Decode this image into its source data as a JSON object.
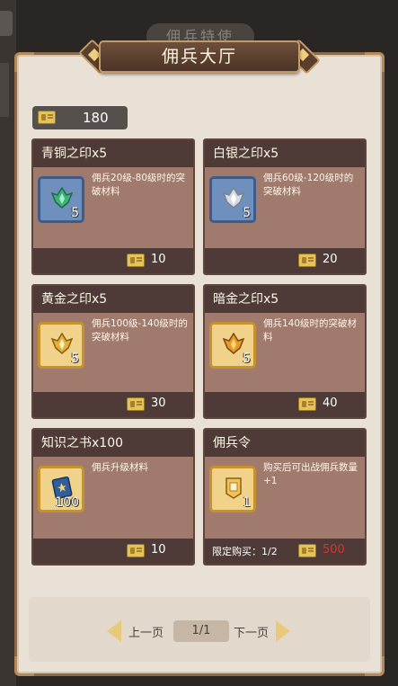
{
  "background": {
    "tab_label": "佣兵特使"
  },
  "title": "佣兵大厅",
  "currency": {
    "amount": "180",
    "icon": "ticket-icon"
  },
  "cards": [
    {
      "name": "青铜之印x5",
      "desc": "佣兵20级-80级时的突破材料",
      "qty": "5",
      "price": "10",
      "icon": "bronze-seal-icon",
      "color": "#43b07a"
    },
    {
      "name": "白银之印x5",
      "desc": "佣兵60级-120级时的突破材料",
      "qty": "5",
      "price": "20",
      "icon": "silver-seal-icon",
      "color": "#d8dde4"
    },
    {
      "name": "黄金之印x5",
      "desc": "佣兵100级-140级时的突破材料",
      "qty": "5",
      "price": "30",
      "icon": "gold-seal-icon",
      "color": "#e0b13c"
    },
    {
      "name": "暗金之印x5",
      "desc": "佣兵140级时的突破材料",
      "qty": "5",
      "price": "40",
      "icon": "dark-gold-seal-icon",
      "color": "#e69a2a"
    },
    {
      "name": "知识之书x100",
      "desc": "佣兵升级材料",
      "qty": "100",
      "price": "10",
      "icon": "knowledge-book-icon",
      "color": "#2f5e9a"
    },
    {
      "name": "佣兵令",
      "desc": "购买后可出战佣兵数量+1",
      "qty": "1",
      "price": "500",
      "limit": "限定购买：1/2",
      "icon": "mercenary-token-icon",
      "color": "#f2c25a"
    }
  ],
  "pager": {
    "prev": "上一页",
    "page": "1/1",
    "next": "下一页"
  }
}
